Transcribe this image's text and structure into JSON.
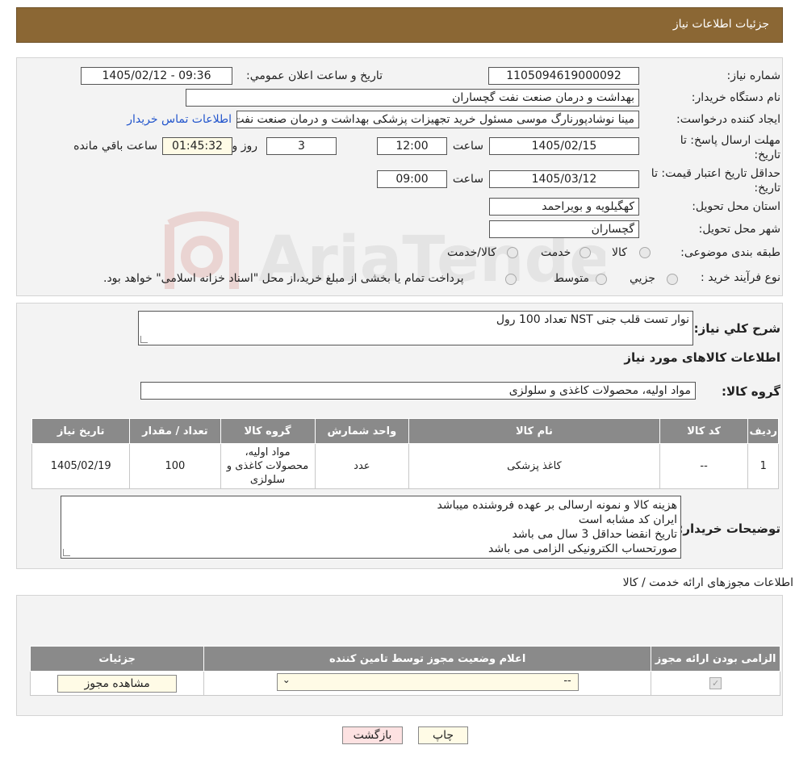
{
  "header": {
    "title": "جزئیات اطلاعات نیاز"
  },
  "watermark": {
    "text": "AriaTender.neT"
  },
  "need": {
    "number_label": "شماره نیاز:",
    "number": "1105094619000092",
    "announce_label": "تاریخ و ساعت اعلان عمومي:",
    "announce": "1405/02/12 - 09:36",
    "buyer_label": "نام دستگاه خریدار:",
    "buyer": "بهداشت و درمان صنعت نفت گچساران",
    "creator_label": "ایجاد کننده درخواست:",
    "creator": "مینا نوشادپورنارگ موسی مسئول خرید تجهیزات پزشکی  بهداشت و درمان صنعت نفت گچساران",
    "contact_link": "اطلاعات تماس خریدار",
    "deadline_label": "مهلت ارسال پاسخ: تا تاریخ:",
    "deadline_date": "1405/02/15",
    "deadline_time_label": "ساعت",
    "deadline_time": "12:00",
    "days": "3",
    "days_label": "روز و",
    "remaining": "01:45:32",
    "remaining_label": "ساعت باقي مانده",
    "validity_label": "حداقل تاریخ اعتبار قیمت: تا تاریخ:",
    "validity_date": "1405/03/12",
    "validity_time_label": "ساعت",
    "validity_time": "09:00",
    "province_label": "استان محل تحویل:",
    "province": "کهگیلویه و بویراحمد",
    "city_label": "شهر محل تحویل:",
    "city": "گچساران",
    "category_label": "طبقه بندی موضوعی:",
    "category_options": [
      "کالا",
      "خدمت",
      "کالا/خدمت"
    ],
    "process_label": "نوع فرآیند خرید :",
    "process_options": [
      "جزیي",
      "متوسط"
    ],
    "process_note": "پرداخت تمام یا بخشی از مبلغ خرید،از محل \"اسناد خزانه اسلامی\" خواهد بود."
  },
  "summary": {
    "label": "شرح كلي نياز:",
    "value": "نوار تست قلب جنی NST تعداد 100 رول",
    "goods_title": "اطلاعات کالاهای مورد نیاز",
    "group_label": "گروه کالا:",
    "group": "مواد اولیه، محصولات کاغذی و سلولزی"
  },
  "items_table": {
    "headers": [
      "ردیف",
      "کد کالا",
      "نام کالا",
      "واحد شمارش",
      "گروه کالا",
      "تعداد / مقدار",
      "تاریخ نیاز"
    ],
    "rows": [
      [
        "1",
        "--",
        "کاغذ پزشکی",
        "عدد",
        "مواد اولیه، محصولات کاغذی و سلولزی",
        "100",
        "1405/02/19"
      ]
    ]
  },
  "buyer_notes": {
    "label": "توضیحات خریدار:",
    "lines": [
      "هزینه کالا و نمونه ارسالی بر عهده فروشنده میباشد",
      "ایران کد مشابه است",
      "تاریخ انقضا حداقل 3 سال می باشد",
      "صورتحساب الکترونیکی الزامی می باشد"
    ]
  },
  "permits": {
    "title": "اطلاعات مجوزهای ارائه خدمت / کالا",
    "headers": [
      "الزامی بودن ارائه مجوز",
      "اعلام وضعیت مجوز توسط تامین کننده",
      "جزئیات"
    ],
    "select_value": "--",
    "view_button": "مشاهده مجوز"
  },
  "footer": {
    "print_button": "چاپ",
    "back_button": "بازگشت"
  },
  "colors": {
    "header_bg": "#8b6734",
    "table_header_bg": "#8a8a8a",
    "link": "#2255cc",
    "back_button_bg": "#fde2e2"
  }
}
